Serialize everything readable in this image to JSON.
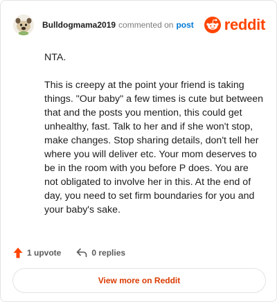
{
  "header": {
    "author": "Bulldogmama2019",
    "commented_on": "commented on",
    "post_link": "post",
    "brand": "reddit"
  },
  "comment": {
    "paragraphs": [
      "NTA.",
      "This is creepy at the point your friend is taking things. \"Our baby\" a few times is cute but between that and the posts you mention, this could get unhealthy, fast. Talk to her and if she won't stop, make changes. Stop sharing details, don't tell her where you will deliver etc. Your mom deserves to be in the room with you before P does. You are not obligated to involve her in this. At the end of day, you need to set firm boundaries for you and your baby's sake."
    ]
  },
  "actions": {
    "upvotes": "1 upvote",
    "replies": "0 replies"
  },
  "footer": {
    "view_more": "View more on Reddit"
  },
  "colors": {
    "reddit_orange": "#ff4500",
    "link_blue": "#0079d3",
    "button_text": "#d93a00"
  },
  "icons": {
    "avatar": "bulldog-avatar-icon",
    "brand": "reddit-snoo-icon",
    "upvote": "upvote-arrow-icon",
    "reply": "reply-arrow-icon"
  }
}
